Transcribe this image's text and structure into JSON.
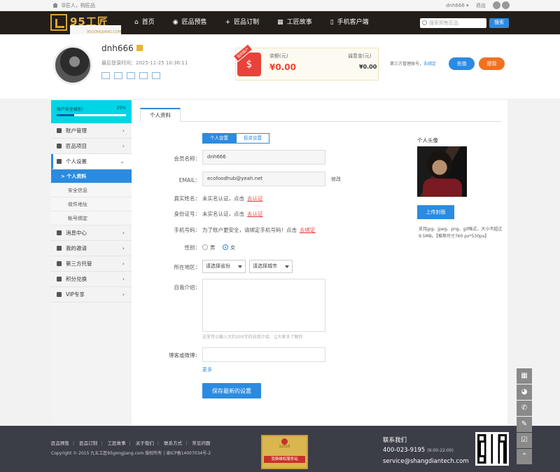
{
  "topbar": {
    "breadcrumb": "寻匠人，购匠品",
    "user": "dnh666 ▾",
    "logout": "退出"
  },
  "nav": {
    "logo_main": "95工匠",
    "logo_sub": "95GONGJIANG.COM",
    "menu": [
      {
        "icon": "home-icon",
        "glyph": "⌂",
        "label": "首页"
      },
      {
        "icon": "eye-icon",
        "glyph": "◉",
        "label": "匠品预售"
      },
      {
        "icon": "plus-icon",
        "glyph": "+",
        "label": "匠品订制"
      },
      {
        "icon": "grid-icon",
        "glyph": "▦",
        "label": "工匠故事"
      },
      {
        "icon": "phone-icon",
        "glyph": "▯",
        "label": "手机客户端"
      }
    ],
    "search_placeholder": "搜索预售匠品",
    "search_button": "搜索"
  },
  "profile": {
    "username": "dnh666",
    "last_login": "最后登录时间：2025-11-25 10:36:11",
    "wallet": {
      "tag": "我的账户",
      "balance_label": "余额(元)",
      "balance": "¥0.00",
      "deposit_label": "诚意金(元)",
      "deposit": "¥0.00"
    },
    "third_party_label": "第三方管理账号，",
    "third_party_link": "去绑定",
    "recharge": "充值",
    "withdraw": "提现"
  },
  "sidebar": {
    "safety_label": "账户安全级别：",
    "safety_pct": "25%",
    "safety_value": 0.25,
    "items": [
      {
        "label": "账户管理",
        "icon": "database-icon"
      },
      {
        "label": "匠品项目",
        "icon": "layers-icon"
      },
      {
        "label": "个人设置",
        "icon": "gear-icon"
      },
      {
        "label": "消息中心",
        "icon": "mail-icon"
      },
      {
        "label": "我的邀请",
        "icon": "heart-icon"
      },
      {
        "label": "第三方托管",
        "icon": "database-icon"
      },
      {
        "label": "积分兑换",
        "icon": "coin-icon"
      },
      {
        "label": "VIP专享",
        "icon": "tag-icon"
      }
    ],
    "sub_items": [
      "> 个人资料",
      "安全信息",
      "收件地址",
      "帐号绑定"
    ]
  },
  "content": {
    "tab": "个人资料",
    "seg_on": "个人设置",
    "seg_off": "投资设置",
    "fields": {
      "member_label": "会员名称：",
      "member_value": "dnh666",
      "email_label": "EMAIL：",
      "email_value": "ecofoodhub@yeah.net",
      "email_modify": "修改",
      "realname_label": "真实姓名：",
      "realname_text": "未实名认证，点击",
      "realname_link": "去认证",
      "id_label": "身份证号：",
      "id_text": "未实名认证，点击",
      "id_link": "去认证",
      "phone_label": "手机号码：",
      "phone_text": "为了账户更安全，请绑定手机号码！点击",
      "phone_link": "去绑定",
      "gender_label": "性别：",
      "gender_male": "男",
      "gender_female": "女",
      "region_label": "所在地区：",
      "province": "请选择省份",
      "city": "请选择城市",
      "intro_label": "自我介绍：",
      "intro_hint": "这里可以输入大约200字的自我介绍，让大家多了解你",
      "blog_label": "博客或微博：",
      "more": "更多",
      "save": "保存最新的设置"
    },
    "avatar_label": "个人头像",
    "upload": "上传封面",
    "upload_tip": "支持jpg、jpeg、png、gif格式，大小不超过9.5MB。【推荐尺寸760 px*530px】"
  },
  "footer": {
    "links": [
      "匠品预售",
      "匠品订制",
      "工匠故事",
      "关于我们",
      "联系方式",
      "常见问题"
    ],
    "copyright": "Copyright © 2015 九五工匠95gongjiang.com 版权所有 | 渝ICP备14007034号-2",
    "cert_num": "12315",
    "cert_title": "消费维权服务站",
    "contact_title": "联系我们",
    "phone": "400-023-9195",
    "hours": "(9:00-22:00)",
    "email": "service@shangdiantech.com"
  }
}
